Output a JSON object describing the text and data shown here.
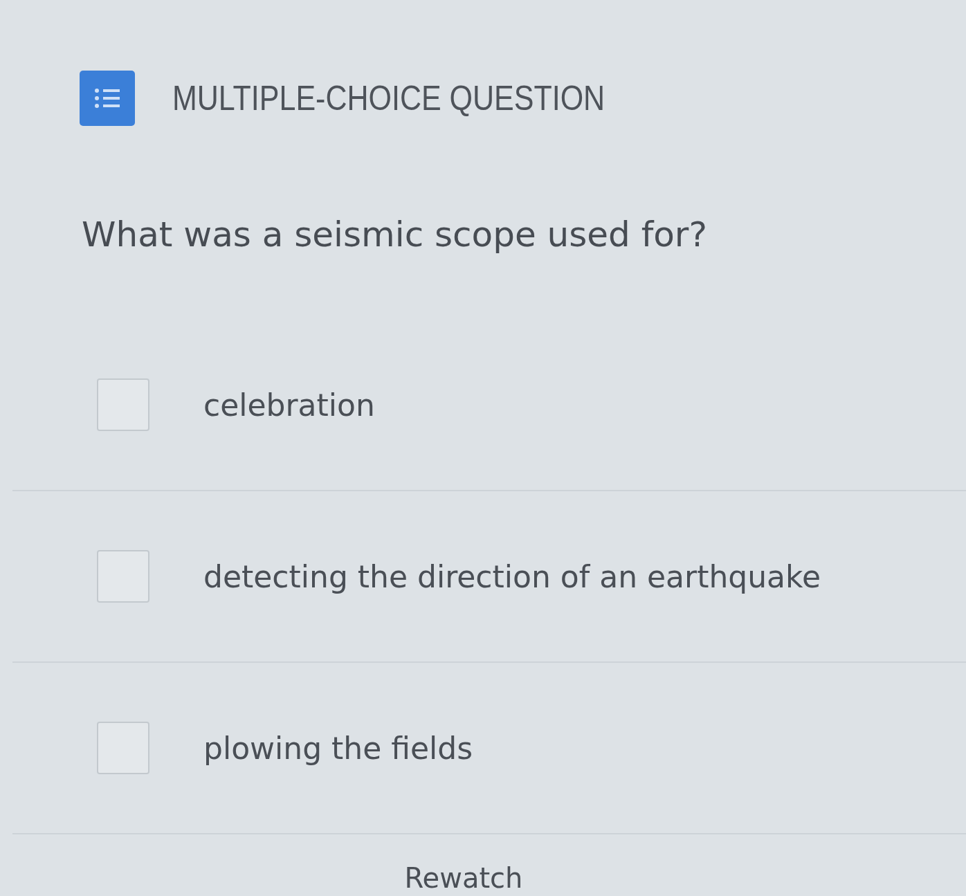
{
  "header": {
    "title": "MULTIPLE-CHOICE QUESTION"
  },
  "question": "What was a seismic scope used for?",
  "options": [
    {
      "label": "celebration",
      "checked": false
    },
    {
      "label": "detecting the direction of an earthquake",
      "checked": false
    },
    {
      "label": "plowing the fields",
      "checked": false
    }
  ],
  "rewatch": "Rewatch"
}
